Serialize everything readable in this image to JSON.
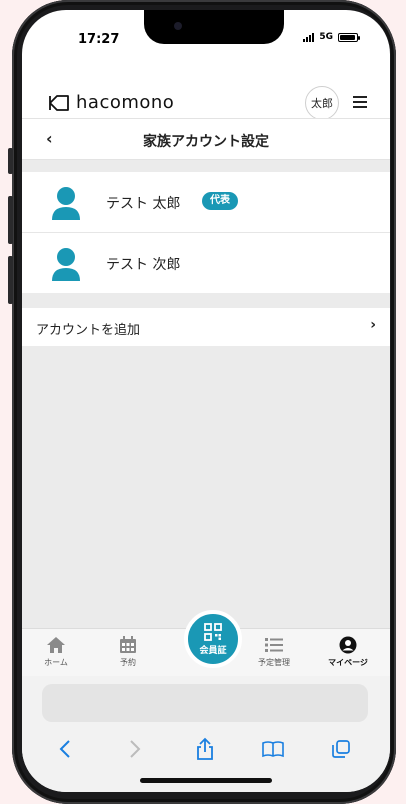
{
  "status_bar": {
    "time": "17:27",
    "network": "5G"
  },
  "header": {
    "logo_text": "hacomono",
    "avatar_label": "太郎"
  },
  "title_bar": {
    "title": "家族アカウント設定"
  },
  "accounts": [
    {
      "name": "テスト 太郎",
      "badge": "代表"
    },
    {
      "name": "テスト 次郎"
    }
  ],
  "add_account": {
    "label": "アカウントを追加"
  },
  "tabbar": {
    "items": [
      {
        "label": "ホーム",
        "icon": "home-icon"
      },
      {
        "label": "予約",
        "icon": "calendar-icon"
      },
      {
        "label": "会員証",
        "icon": "qr-code-icon"
      },
      {
        "label": "予定管理",
        "icon": "list-icon"
      },
      {
        "label": "マイページ",
        "icon": "user-circle-icon",
        "active": true
      }
    ]
  },
  "colors": {
    "accent": "#1a98b5",
    "background": "#ebebeb"
  }
}
